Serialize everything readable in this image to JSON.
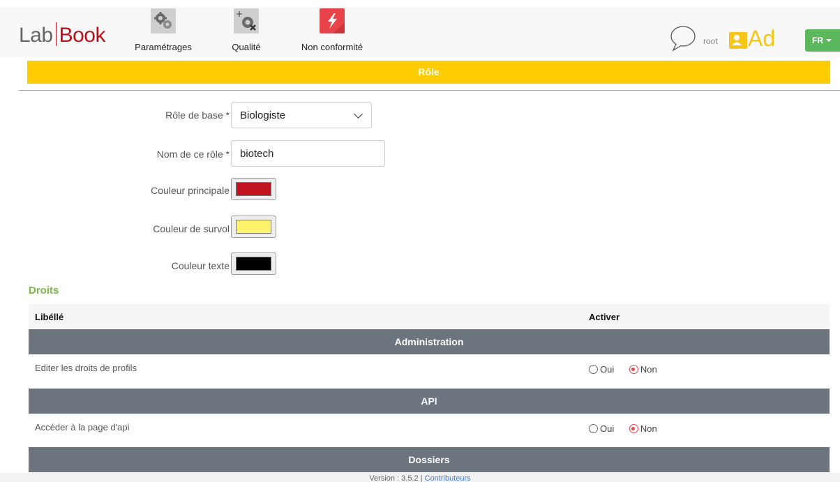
{
  "logo": {
    "part1": "Lab",
    "part2": "Book"
  },
  "nav": {
    "items": [
      {
        "label": "Paramétrages",
        "icon": "gears-icon"
      },
      {
        "label": "Qualité",
        "icon": "quality-icon"
      },
      {
        "label": "Non conformité",
        "icon": "lightning-icon"
      }
    ]
  },
  "user": {
    "name": "root",
    "initials": "Ad"
  },
  "lang": {
    "label": "FR"
  },
  "page": {
    "title": "Rôle"
  },
  "form": {
    "base_role_label": "Rôle de base *",
    "base_role_value": "Biologiste",
    "role_name_label": "Nom de ce rôle *",
    "role_name_value": "biotech",
    "main_color_label": "Couleur principale",
    "main_color_value": "#c1121f",
    "hover_color_label": "Couleur de survol",
    "hover_color_value": "#fff36b",
    "text_color_label": "Couleur texte",
    "text_color_value": "#000000"
  },
  "rights": {
    "section_title": "Droits",
    "col_label": "Libéllé",
    "col_activate": "Activer",
    "yes_label": "Oui",
    "no_label": "Non",
    "groups": [
      {
        "name": "Administration",
        "rows": [
          {
            "label": "Editer les droits de profils",
            "value": "Non"
          }
        ]
      },
      {
        "name": "API",
        "rows": [
          {
            "label": "Accéder à la page d'api",
            "value": "Non"
          }
        ]
      },
      {
        "name": "Dossiers",
        "rows": []
      }
    ]
  },
  "footer": {
    "version": "Version : 3.5.2 |",
    "contributors": "Contributeurs"
  },
  "colors": {
    "accent_yellow": "#ffcc00",
    "group_gray": "#6c757d",
    "green": "#5cb85c",
    "brand_red": "#b5121b"
  }
}
